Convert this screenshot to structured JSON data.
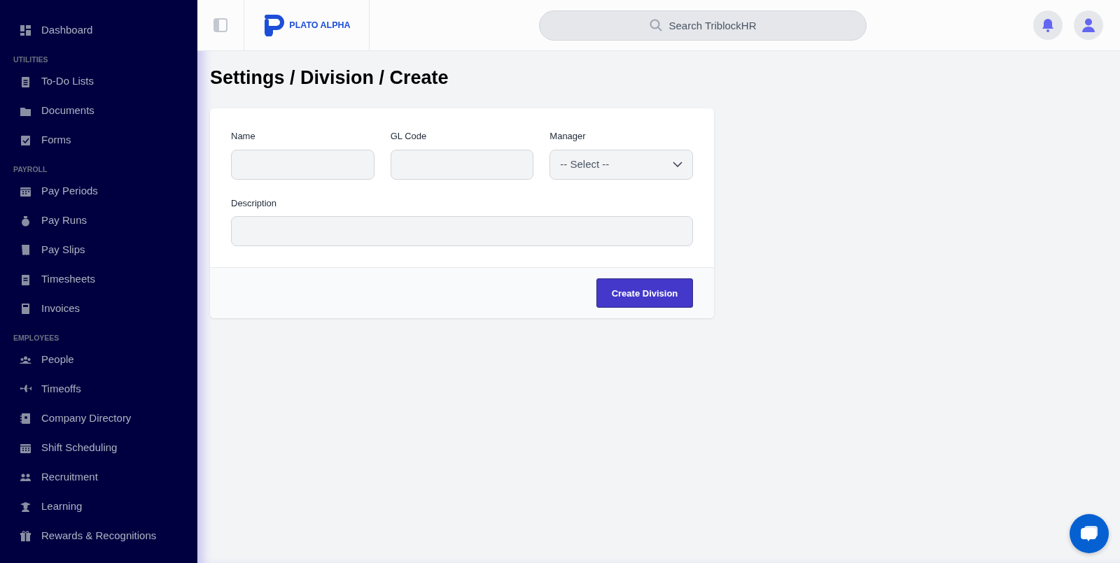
{
  "sidebar": {
    "sections": [
      {
        "items": [
          {
            "label": "Dashboard"
          }
        ]
      },
      {
        "header": "UTILITIES",
        "items": [
          {
            "label": "To-Do Lists"
          },
          {
            "label": "Documents"
          },
          {
            "label": "Forms"
          }
        ]
      },
      {
        "header": "PAYROLL",
        "items": [
          {
            "label": "Pay Periods"
          },
          {
            "label": "Pay Runs"
          },
          {
            "label": "Pay Slips"
          },
          {
            "label": "Timesheets"
          },
          {
            "label": "Invoices"
          }
        ]
      },
      {
        "header": "EMPLOYEES",
        "items": [
          {
            "label": "People"
          },
          {
            "label": "Timeoffs"
          },
          {
            "label": "Company Directory"
          },
          {
            "label": "Shift Scheduling"
          },
          {
            "label": "Recruitment"
          },
          {
            "label": "Learning"
          },
          {
            "label": "Rewards & Recognitions"
          }
        ]
      }
    ]
  },
  "topbar": {
    "logo_text": "PLATO ALPHA",
    "search": {
      "placeholder": "Search TriblockHR"
    }
  },
  "page_title": "Settings / Division / Create",
  "form": {
    "fields": [
      {
        "kind": "text",
        "label": "Name"
      },
      {
        "kind": "text",
        "label": "GL Code"
      },
      {
        "kind": "select",
        "label": "Manager",
        "value": "-- Select --"
      },
      {
        "kind": "text",
        "label": "Description",
        "wide": true
      }
    ],
    "submit": "Create Division"
  }
}
